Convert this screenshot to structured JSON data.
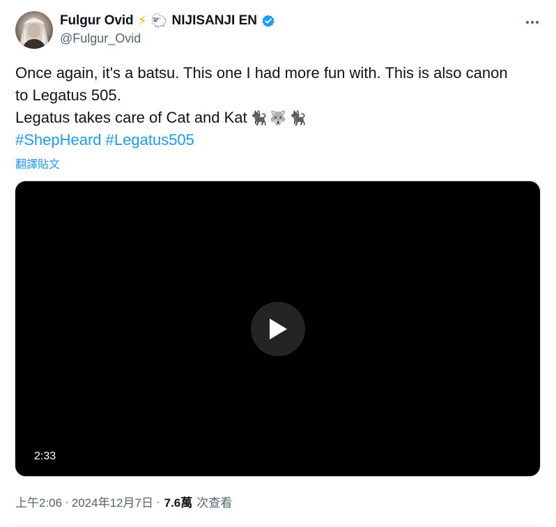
{
  "author": {
    "display_name": "Fulgur Ovid",
    "name_emojis": [
      "⚡",
      "🐑"
    ],
    "affiliation": "NIJISANJI EN",
    "handle": "@Fulgur_Ovid",
    "verified": true
  },
  "tweet": {
    "line1": "Once again, it's a batsu. This one I had more fun with. This is also canon",
    "line2": "to Legatus 505.",
    "line3": "Legatus takes care of Cat and Kat",
    "line3_emojis": "🐈‍⬛🐺🐈‍⬛",
    "hashtags": [
      "#ShepHeard",
      "#Legatus505"
    ],
    "translate_label": "翻譯貼文"
  },
  "video": {
    "duration": "2:33"
  },
  "meta": {
    "time": "上午2:06",
    "date": "2024年12月7日",
    "views_count": "7.6萬",
    "views_label": "次查看",
    "separator": "·"
  },
  "colors": {
    "link": "#1d9bf0",
    "secondary_text": "#536471",
    "verified_badge": "#1d9bf0"
  },
  "icons": {
    "verified": "verified-badge-icon",
    "more": "more-dots-icon",
    "play": "play-icon"
  }
}
